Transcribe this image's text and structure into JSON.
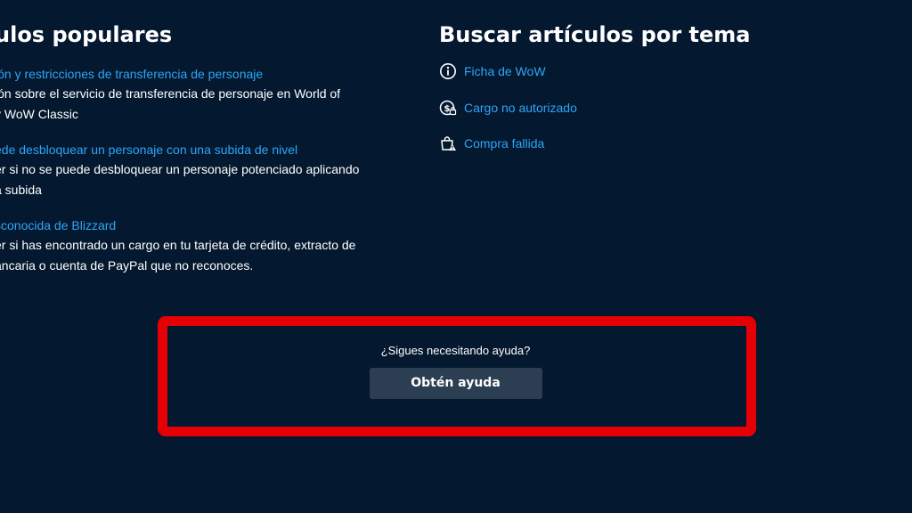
{
  "popular": {
    "heading": "ulos populares",
    "articles": [
      {
        "title": "ión y restricciones de transferencia de personaje",
        "desc_line1": "ión sobre el servicio de transferencia de personaje en World of",
        "desc_line2": "y WoW Classic"
      },
      {
        "title": "ede desbloquear un personaje con una subida de nivel",
        "desc_line1": "er si no se puede desbloquear un personaje potenciado aplicando",
        "desc_line2": "a subida"
      },
      {
        "title": "sconocida de Blizzard",
        "desc_line1": "er si has encontrado un cargo en tu tarjeta de crédito, extracto de",
        "desc_line2": "ancaria o cuenta de PayPal que no reconoces."
      }
    ]
  },
  "topics": {
    "heading": "Buscar artículos por tema",
    "items": [
      {
        "label": "Ficha de WoW",
        "icon": "info-circle-icon"
      },
      {
        "label": "Cargo no autorizado",
        "icon": "dollar-lock-icon"
      },
      {
        "label": "Compra fallida",
        "icon": "shopping-bag-alert-icon"
      }
    ]
  },
  "help": {
    "question": "¿Sigues necesitando ayuda?",
    "button_label": "Obtén ayuda"
  },
  "colors": {
    "background": "#04182f",
    "link": "#2ea6f7",
    "highlight": "#e50006",
    "button": "#2c3e52"
  }
}
